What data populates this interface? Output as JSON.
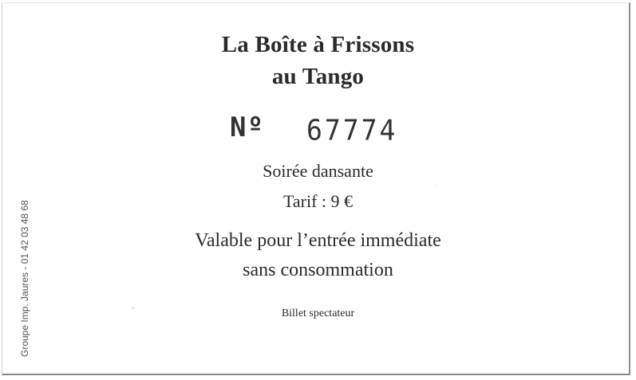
{
  "ticket": {
    "title_line1": "La Boîte à Frissons",
    "title_line2": "au Tango",
    "number_label": "Nº",
    "number_value": "67774",
    "event": "Soirée dansante",
    "price": "Tarif : 9 €",
    "validity_line1": "Valable pour l’entrée immédiate",
    "validity_line2": "sans consommation",
    "ticket_type": "Billet spectateur",
    "printer_credit": "Groupe Imp. Jaures - 01 42 03 48 68"
  }
}
